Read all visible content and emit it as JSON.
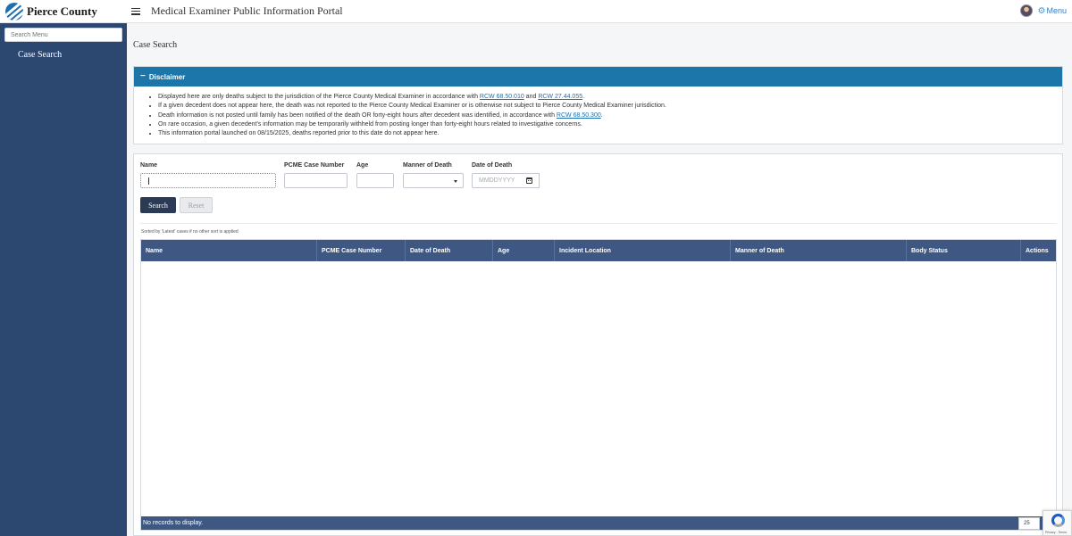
{
  "header": {
    "brand": "Pierce County",
    "title": "Medical Examiner Public Information Portal",
    "menu_label": "Menu",
    "icons": {
      "hamburger": "hamburger-icon",
      "avatar": "user-avatar",
      "menu": "gear-icon"
    }
  },
  "sidebar": {
    "search_placeholder": "Search Menu",
    "items": [
      {
        "label": "Case Search"
      }
    ]
  },
  "page": {
    "title": "Case Search"
  },
  "disclaimer": {
    "title": "Disclaimer",
    "toggle": "−",
    "items": [
      {
        "before": "Displayed here are only deaths subject to the jurisdiction of the Pierce County Medical Examiner in accordance with ",
        "link1": "RCW 68.50.010",
        "middle": " and ",
        "link2": "RCW 27.44.055",
        "after": "."
      },
      {
        "text": "If a given decedent does not appear here, the death was not reported to the Pierce County Medical Examiner or is otherwise not subject to Pierce County Medical Examiner jurisdiction."
      },
      {
        "before": "Death information is not posted until family has been notified of the death OR forty-eight hours after decedent was identified, in accordance with ",
        "link1": "RCW 68.50.300",
        "after": "."
      },
      {
        "text": "On rare occasion, a given decedent's information may be temporarily withheld from posting longer than forty-eight hours related to investigative concerns."
      },
      {
        "text": "This information portal launched on 08/15/2025, deaths reported prior to this date do not appear here."
      }
    ]
  },
  "search_form": {
    "fields": {
      "name": {
        "label": "Name",
        "value": ""
      },
      "case_number": {
        "label": "PCME Case Number",
        "value": ""
      },
      "age": {
        "label": "Age",
        "value": ""
      },
      "manner": {
        "label": "Manner of Death",
        "value": ""
      },
      "date": {
        "label": "Date of Death",
        "placeholder": "MMDDYYYY"
      }
    },
    "search_button": "Search",
    "reset_button": "Reset",
    "sort_note": "Sorted by 'Latest' cases if no other sort is applied"
  },
  "grid": {
    "columns": [
      "Name",
      "PCME Case Number",
      "Date of Death",
      "Age",
      "Incident Location",
      "Manner of Death",
      "Body Status",
      "Actions"
    ],
    "rows": [],
    "empty_text": "No records to display.",
    "page_size": "25"
  },
  "recaptcha": {
    "text": "Privacy - Terms"
  },
  "colors": {
    "sidebar": "#2c4770",
    "disclaimer_header": "#1c76a9",
    "grid_header": "#3e5883",
    "search_button": "#2b3a55",
    "link": "#1c6fae"
  }
}
